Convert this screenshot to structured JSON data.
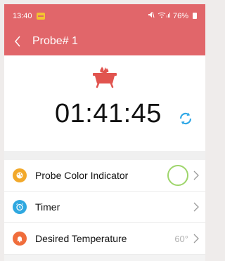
{
  "status_bar": {
    "time": "13:40",
    "signal_text": " … ···",
    "battery": "76%"
  },
  "header": {
    "title": "Probe# 1"
  },
  "hero": {
    "timer": "01:41:45"
  },
  "settings": [
    {
      "label": "Probe Color Indicator",
      "icon": "palette-icon",
      "icon_color": "#f2a92b"
    },
    {
      "label": "Timer",
      "icon": "alarm-clock-icon",
      "icon_color": "#2fa8e0"
    },
    {
      "label": "Desired Temperature",
      "icon": "bell-icon",
      "icon_color": "#f06d3c",
      "value": "60°"
    }
  ],
  "colors": {
    "accent": "#e1666a",
    "probe_color_ring": "#9ed56b",
    "refresh": "#2da7e6"
  }
}
